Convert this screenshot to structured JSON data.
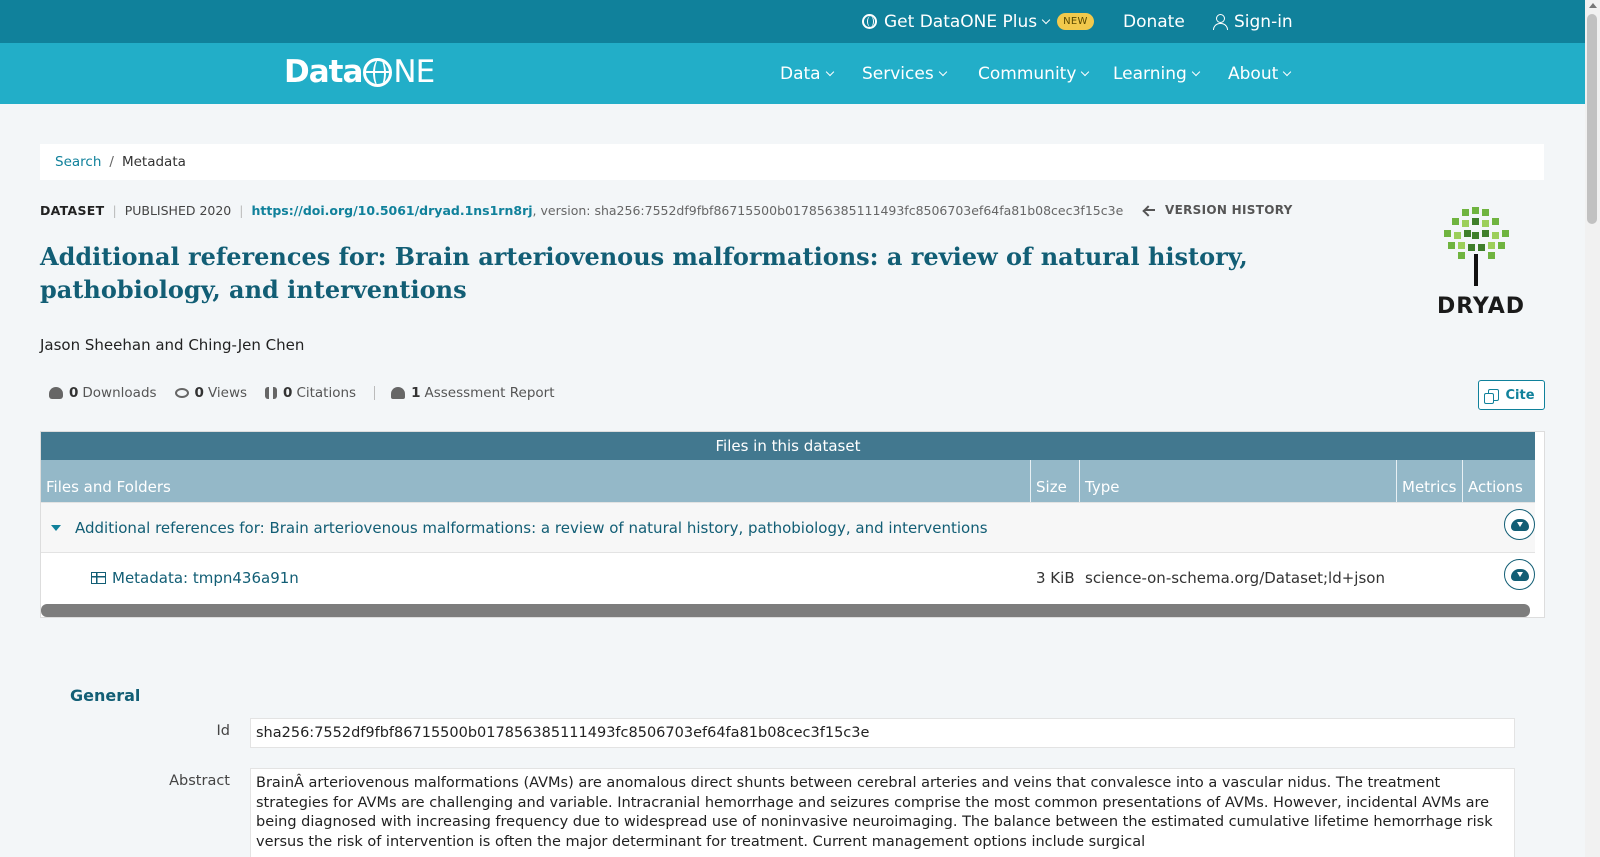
{
  "topbar": {
    "plus_label": "Get DataONE Plus",
    "new_badge": "NEW",
    "donate_label": "Donate",
    "signin_label": "Sign-in"
  },
  "logo": {
    "part1": "Data",
    "part2": "NE"
  },
  "nav": {
    "items": [
      "Data",
      "Services",
      "Community",
      "Learning",
      "About"
    ]
  },
  "breadcrumb": {
    "search": "Search",
    "separator": "/",
    "current": "Metadata"
  },
  "dataset": {
    "type_label": "DATASET",
    "published": "PUBLISHED 2020",
    "doi": "https://doi.org/10.5061/dryad.1ns1rn8rj",
    "version": ", version: sha256:7552df9fbf86715500b017856385111493fc8506703ef64fa81b08cec3f15c3e",
    "version_history": "VERSION HISTORY",
    "title": "Additional references for: Brain arteriovenous malformations: a review of natural history, pathobiology, and interventions",
    "authors": "Jason Sheehan and Ching-Jen Chen",
    "repository_logo_text": "DRYAD"
  },
  "metrics": {
    "downloads_count": "0",
    "downloads_label": "Downloads",
    "views_count": "0",
    "views_label": "Views",
    "citations_count": "0",
    "citations_label": "Citations",
    "assessment_count": "1",
    "assessment_label": "Assessment Report",
    "cite_label": "Cite"
  },
  "files": {
    "caption": "Files in this dataset",
    "columns": [
      "Files and Folders",
      "Size",
      "Type",
      "Metrics",
      "Actions"
    ],
    "rows": [
      {
        "name": "Additional references for: Brain arteriovenous malformations: a review of natural history, pathobiology, and interventions",
        "size": "",
        "type": ""
      },
      {
        "name": "Metadata: tmpn436a91n",
        "size": "3 KiB",
        "type": "science-on-schema.org/Dataset;ld+json"
      }
    ]
  },
  "general": {
    "heading": "General",
    "id_label": "Id",
    "id_value": "sha256:7552df9fbf86715500b017856385111493fc8506703ef64fa81b08cec3f15c3e",
    "abstract_label": "Abstract",
    "abstract_value": "BrainÂ arteriovenous malformations (AVMs) are anomalous direct shunts between cerebral arteries and veins that convalesce into a vascular nidus. The treatment strategies for AVMs are challenging and variable. Intracranial hemorrhage and seizures comprise the most common presentations of AVMs. However, incidental AVMs are being diagnosed with increasing frequency due to widespread use of noninvasive neuroimaging. The balance between the estimated cumulative lifetime hemorrhage risk versus the risk of intervention is often the major determinant for treatment. Current management options include surgical"
  },
  "colors": {
    "topbar": "#10819b",
    "navbar": "#22aec8",
    "title": "#125e75",
    "table_caption": "#42788f",
    "table_header": "#94b8c8"
  }
}
